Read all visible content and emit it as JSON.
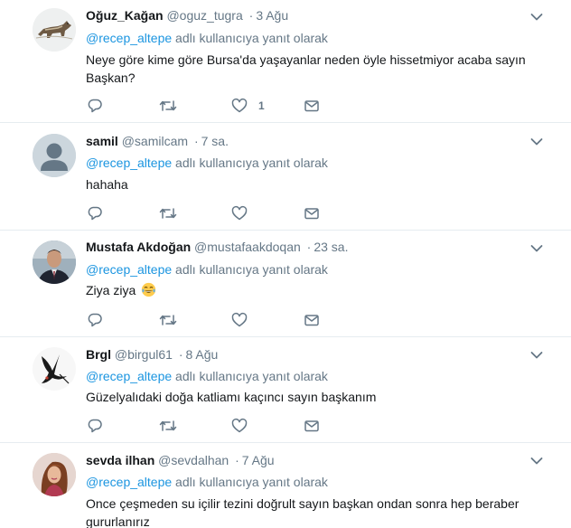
{
  "tweets": [
    {
      "name": "Oğuz_Kağan",
      "handle": "@oguz_tugra",
      "time": "3 Ağu",
      "reply_mention": "@recep_altepe",
      "reply_suffix": " adlı kullanıcıya yanıt olarak",
      "text_line1": "Neye göre kime göre Bursa'da yaşayanlar neden öyle hissetmiyor acaba sayın",
      "text_line2": "Başkan?",
      "like_count": "1",
      "avatar_icon": "wolf-avatar-icon"
    },
    {
      "name": "samil",
      "handle": "@samilcam",
      "time": "7 sa.",
      "reply_mention": "@recep_altepe",
      "reply_suffix": " adlı kullanıcıya yanıt olarak",
      "text": "hahaha",
      "avatar_icon": "default-user-avatar-icon"
    },
    {
      "name": "Mustafa Akdoğan",
      "handle": "@mustafaakdoqan",
      "time": "23 sa.",
      "reply_mention": "@recep_altepe",
      "reply_suffix": " adlı kullanıcıya yanıt olarak",
      "text": "Ziya ziya",
      "emoji": "face-with-tears-of-joy-icon",
      "avatar_icon": "man-portrait-avatar-icon"
    },
    {
      "name": "Brgl",
      "handle": "@birgul61",
      "time": "8 Ağu",
      "reply_mention": "@recep_altepe",
      "reply_suffix": " adlı kullanıcıya yanıt olarak",
      "text": "Güzelyalıdaki doğa katliamı kaçıncı sayın başkanım",
      "avatar_icon": "bird-sketch-avatar-icon"
    },
    {
      "name": "sevda ilhan",
      "handle": "@sevdalhan",
      "time": "7 Ağu",
      "reply_mention": "@recep_altepe",
      "reply_suffix": " adlı kullanıcıya yanıt olarak",
      "text_line1": "Once çeşmeden su içilir tezini doğrult sayın başkan ondan sonra hep beraber",
      "text_line2": "gururlanırız",
      "avatar_icon": "woman-portrait-avatar-icon"
    }
  ],
  "separator": "·",
  "colors": {
    "link": "#1b95e0",
    "muted": "#657786",
    "text": "#14171a",
    "divider": "#e6ecf0"
  },
  "action_icons": [
    "reply-icon",
    "retweet-icon",
    "like-icon",
    "direct-message-icon"
  ]
}
